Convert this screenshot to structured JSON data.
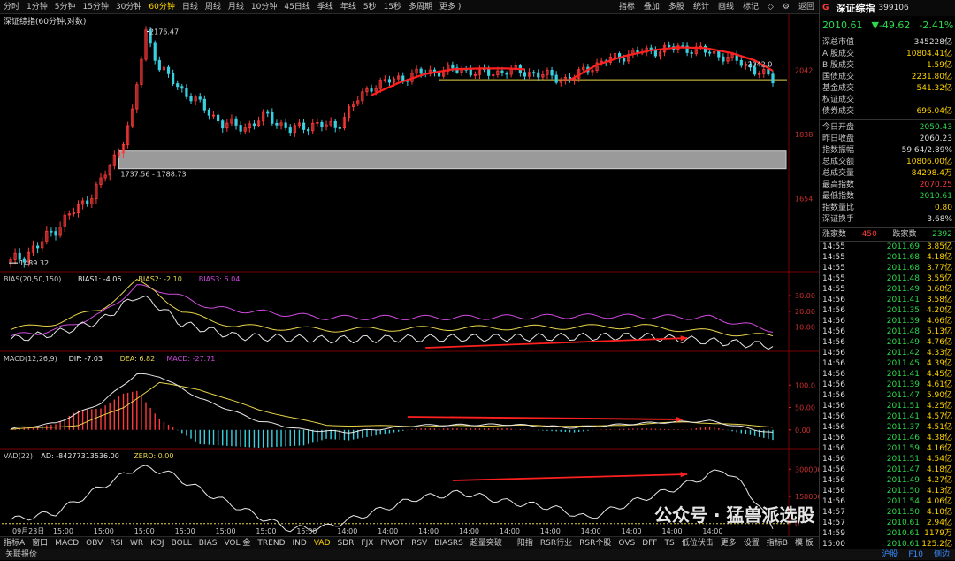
{
  "topbar": {
    "periods": [
      "分时",
      "1分钟",
      "5分钟",
      "15分钟",
      "30分钟",
      "60分钟",
      "日线",
      "周线",
      "月线",
      "10分钟",
      "45日线",
      "季线",
      "年线",
      "5秒",
      "15秒",
      "多周期",
      "更多 )"
    ],
    "active_period": "60分钟",
    "right": [
      "指标",
      "叠加",
      "多股",
      "统计",
      "画线",
      "标记",
      "◇",
      "⚙",
      "返回"
    ]
  },
  "chart_title": "深证综指(60分钟,对数)",
  "price_pane": {
    "y_ticks": [
      {
        "label": "2042",
        "v": 2042
      },
      {
        "label": "1838",
        "v": 1838
      },
      {
        "label": "1654",
        "v": 1654
      }
    ],
    "high_label": "2176.47",
    "low_label": "1489.32",
    "last_label": "2042.0",
    "gap_label": "1737.56 - 1788.73",
    "gap_range": [
      1737.56,
      1788.73
    ],
    "yrange": [
      1470,
      2200
    ],
    "hline": 2010.61
  },
  "bias_pane": {
    "legend": [
      {
        "text": "BIAS(20,50,150)",
        "color": "#c8c8c8"
      },
      {
        "text": "BIAS1: -4.06",
        "color": "#e8e8e8"
      },
      {
        "text": "BIAS2: -2.10",
        "color": "#e8d44a"
      },
      {
        "text": "BIAS3: 6.04",
        "color": "#d04ae0"
      }
    ],
    "y_ticks": [
      {
        "label": "30.00",
        "v": 30
      },
      {
        "label": "20.00",
        "v": 20
      },
      {
        "label": "10.00",
        "v": 10
      }
    ],
    "yrange": [
      -5,
      38
    ]
  },
  "macd_pane": {
    "legend": [
      {
        "text": "MACD(12,26,9)",
        "color": "#c8c8c8"
      },
      {
        "text": "DIF: -7.03",
        "color": "#e8e8e8"
      },
      {
        "text": "DEA: 6.82",
        "color": "#e8d44a"
      },
      {
        "text": "MACD: -27.71",
        "color": "#d04ae0"
      }
    ],
    "y_ticks": [
      {
        "label": "100.0",
        "v": 100
      },
      {
        "label": "50.00",
        "v": 50
      },
      {
        "label": "0.00",
        "v": 0
      }
    ],
    "yrange": [
      -40,
      150
    ]
  },
  "vad_pane": {
    "legend": [
      {
        "text": "VAD(22)",
        "color": "#c8c8c8"
      },
      {
        "text": "AD: -84277313536.00",
        "color": "#e8e8e8"
      },
      {
        "text": "ZERO: 0.00",
        "color": "#e8d44a"
      }
    ],
    "y_ticks": [
      {
        "label": "300000",
        "v": 300000
      },
      {
        "label": "150000",
        "v": 150000
      },
      {
        "label": "0",
        "v": 0
      }
    ],
    "yrange": [
      -50000,
      350000
    ]
  },
  "x_axis": {
    "labels": [
      {
        "label": "09月23日",
        "i": 0
      },
      {
        "label": "15:00",
        "i": 9
      },
      {
        "label": "15:00",
        "i": 18
      },
      {
        "label": "15:00",
        "i": 27
      },
      {
        "label": "15:00",
        "i": 36
      },
      {
        "label": "15:00",
        "i": 45
      },
      {
        "label": "15:00",
        "i": 54
      },
      {
        "label": "15:00",
        "i": 63
      },
      {
        "label": "14:00",
        "i": 72
      },
      {
        "label": "14:00",
        "i": 81
      },
      {
        "label": "14:00",
        "i": 90
      },
      {
        "label": "14:00",
        "i": 99
      },
      {
        "label": "14:00",
        "i": 108
      },
      {
        "label": "14:00",
        "i": 117
      },
      {
        "label": "14:00",
        "i": 126
      },
      {
        "label": "14:00",
        "i": 135
      },
      {
        "label": "14:00",
        "i": 144
      },
      {
        "label": "14:00",
        "i": 153
      }
    ]
  },
  "bottombar": {
    "tabs": [
      "指标A",
      "窗口",
      "MACD",
      "OBV",
      "RSI",
      "WR",
      "KDJ",
      "BOLL",
      "BIAS",
      "VOL 金",
      "TREND",
      "IND",
      "VAD",
      "SDR",
      "FJX",
      "PIVOT",
      "RSV",
      "BIASRS",
      "超量突破",
      "一阳指",
      "RSR行业",
      "RSR个股",
      "OVS",
      "DFF",
      "TS",
      "低位伏击",
      "更多",
      "设置"
    ],
    "active_tab": "VAD",
    "right": [
      "指标B",
      "模 板",
      "+",
      "-",
      "60分钟"
    ]
  },
  "status": {
    "left": "关联报价",
    "right": [
      "沪股",
      "F10",
      "侧边"
    ]
  },
  "right_panel": {
    "flag": "G",
    "name": "深证综指",
    "code": "399106",
    "price": "2010.61",
    "change": "▼-49.62",
    "pct": "-2.41%",
    "caps": [
      {
        "l": "深总市值",
        "v": "345228亿",
        "c": "white"
      },
      {
        "l": "A 股成交",
        "v": "10804.41亿",
        "c": "yellow"
      },
      {
        "l": "B 股成交",
        "v": "1.59亿",
        "c": "yellow"
      },
      {
        "l": "国债成交",
        "v": "2231.80亿",
        "c": "yellow"
      },
      {
        "l": "基金成交",
        "v": "541.32亿",
        "c": "yellow"
      },
      {
        "l": "权证成交",
        "v": "",
        "c": "yellow"
      },
      {
        "l": "债券成交",
        "v": "696.04亿",
        "c": "yellow"
      }
    ],
    "stats": [
      {
        "l": "今日开盘",
        "v": "2050.43",
        "c": "green"
      },
      {
        "l": "昨日收盘",
        "v": "2060.23",
        "c": "white"
      },
      {
        "l": "指数振幅",
        "v": "59.64/2.89%",
        "c": "white"
      },
      {
        "l": "总成交额",
        "v": "10806.00亿",
        "c": "yellow"
      },
      {
        "l": "总成交量",
        "v": "84298.4万",
        "c": "yellow"
      },
      {
        "l": "最高指数",
        "v": "2070.25",
        "c": "red"
      },
      {
        "l": "最低指数",
        "v": "2010.61",
        "c": "green"
      },
      {
        "l": "指数量比",
        "v": "0.80",
        "c": "yellow"
      },
      {
        "l": "深证换手",
        "v": "3.68%",
        "c": "white"
      }
    ],
    "updown": {
      "up_label": "涨家数",
      "up": "450",
      "down_label": "跌家数",
      "down": "2392"
    },
    "ticks": [
      [
        "14:55",
        "2011.69",
        "3.85亿"
      ],
      [
        "14:55",
        "2011.68",
        "4.18亿"
      ],
      [
        "14:55",
        "2011.68",
        "3.77亿"
      ],
      [
        "14:55",
        "2011.48",
        "3.55亿"
      ],
      [
        "14:55",
        "2011.49",
        "3.68亿"
      ],
      [
        "14:56",
        "2011.41",
        "3.58亿"
      ],
      [
        "14:56",
        "2011.35",
        "4.20亿"
      ],
      [
        "14:56",
        "2011.39",
        "4.66亿"
      ],
      [
        "14:56",
        "2011.48",
        "5.13亿"
      ],
      [
        "14:56",
        "2011.49",
        "4.76亿"
      ],
      [
        "14:56",
        "2011.42",
        "4.33亿"
      ],
      [
        "14:56",
        "2011.45",
        "4.39亿"
      ],
      [
        "14:56",
        "2011.41",
        "4.45亿"
      ],
      [
        "14:56",
        "2011.39",
        "4.61亿"
      ],
      [
        "14:56",
        "2011.47",
        "5.90亿"
      ],
      [
        "14:56",
        "2011.51",
        "4.25亿"
      ],
      [
        "14:56",
        "2011.41",
        "4.57亿"
      ],
      [
        "14:56",
        "2011.37",
        "4.51亿"
      ],
      [
        "14:56",
        "2011.46",
        "4.38亿"
      ],
      [
        "14:56",
        "2011.59",
        "4.16亿"
      ],
      [
        "14:56",
        "2011.51",
        "4.54亿"
      ],
      [
        "14:56",
        "2011.47",
        "4.18亿"
      ],
      [
        "14:56",
        "2011.49",
        "4.27亿"
      ],
      [
        "14:56",
        "2011.50",
        "4.13亿"
      ],
      [
        "14:56",
        "2011.54",
        "4.06亿"
      ],
      [
        "14:57",
        "2011.50",
        "4.10亿"
      ],
      [
        "14:57",
        "2010.61",
        "2.94亿"
      ],
      [
        "14:59",
        "2010.61",
        "1179万"
      ],
      [
        "15:00",
        "2010.61",
        "125.2亿"
      ]
    ]
  },
  "watermark": "公众号 · 猛兽派选股",
  "colors": {
    "up": "#ff3a3a",
    "down": "#39d0e0",
    "trend": "#ff2020",
    "dif": "#e8e8e8",
    "dea": "#e8d44a",
    "bias3": "#d04ae0",
    "grid": "#5a0000"
  }
}
